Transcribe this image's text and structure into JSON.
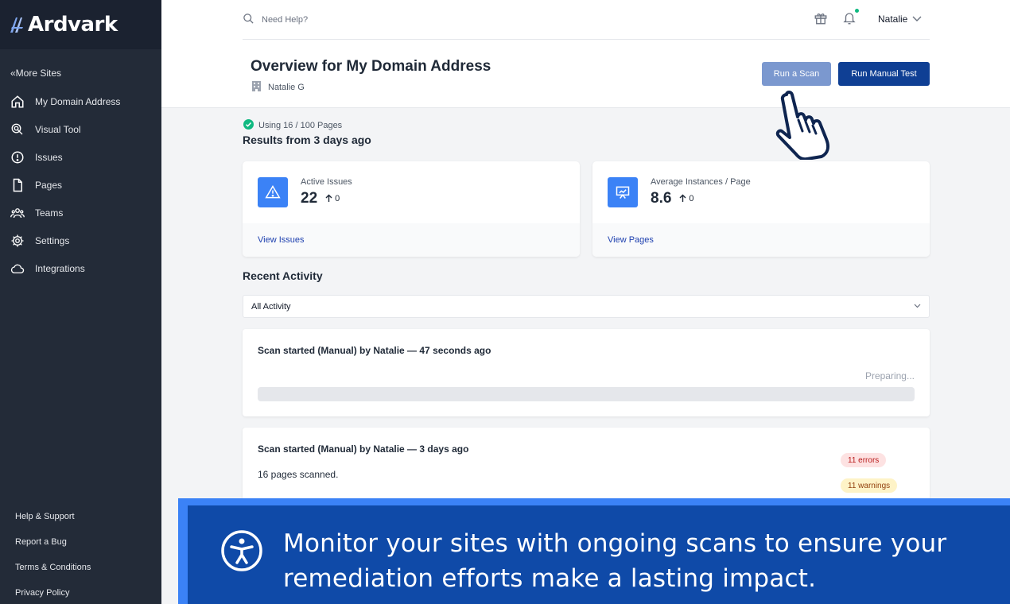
{
  "app": {
    "name": "Ardvark"
  },
  "sidebar": {
    "more_sites": "«More Sites",
    "items": [
      {
        "label": "My Domain Address",
        "icon": "home-icon"
      },
      {
        "label": "Visual Tool",
        "icon": "pointer-icon"
      },
      {
        "label": "Issues",
        "icon": "alert-circle-icon"
      },
      {
        "label": "Pages",
        "icon": "document-icon"
      },
      {
        "label": "Teams",
        "icon": "users-icon"
      },
      {
        "label": "Settings",
        "icon": "gear-icon"
      },
      {
        "label": "Integrations",
        "icon": "cloud-icon"
      }
    ],
    "footer": [
      "Help & Support",
      "Report a Bug",
      "Terms & Conditions",
      "Privacy Policy"
    ]
  },
  "topbar": {
    "search_placeholder": "Need Help?",
    "user_name": "Natalie"
  },
  "header": {
    "title": "Overview for My Domain Address",
    "organization": "Natalie G",
    "run_scan_label": "Run a Scan",
    "run_manual_label": "Run Manual Test"
  },
  "summary": {
    "usage": "Using 16 / 100 Pages",
    "results_heading": "Results from 3 days ago"
  },
  "cards": [
    {
      "label": "Active Issues",
      "value": "22",
      "delta": "0",
      "link": "View Issues",
      "icon": "warning-icon"
    },
    {
      "label": "Average Instances / Page",
      "value": "8.6",
      "delta": "0",
      "link": "View Pages",
      "icon": "presentation-chart-icon"
    }
  ],
  "activity": {
    "heading": "Recent Activity",
    "filter_value": "All Activity",
    "items": [
      {
        "title": "Scan started (Manual) by Natalie — 47 seconds ago",
        "status": "Preparing...",
        "progress": 0
      },
      {
        "title": "Scan started (Manual) by Natalie — 3 days ago",
        "detail": "16 pages scanned.",
        "errors": "11 errors",
        "warnings": "11 warnings"
      }
    ]
  },
  "banner": {
    "text": "Monitor your sites with ongoing scans to ensure your remediation efforts make a lasting impact."
  },
  "colors": {
    "sidebar_bg": "#232b38",
    "primary": "#0f3f94",
    "accent": "#3b82f6",
    "banner_bg": "#0f4aa8",
    "success": "#10b981"
  }
}
